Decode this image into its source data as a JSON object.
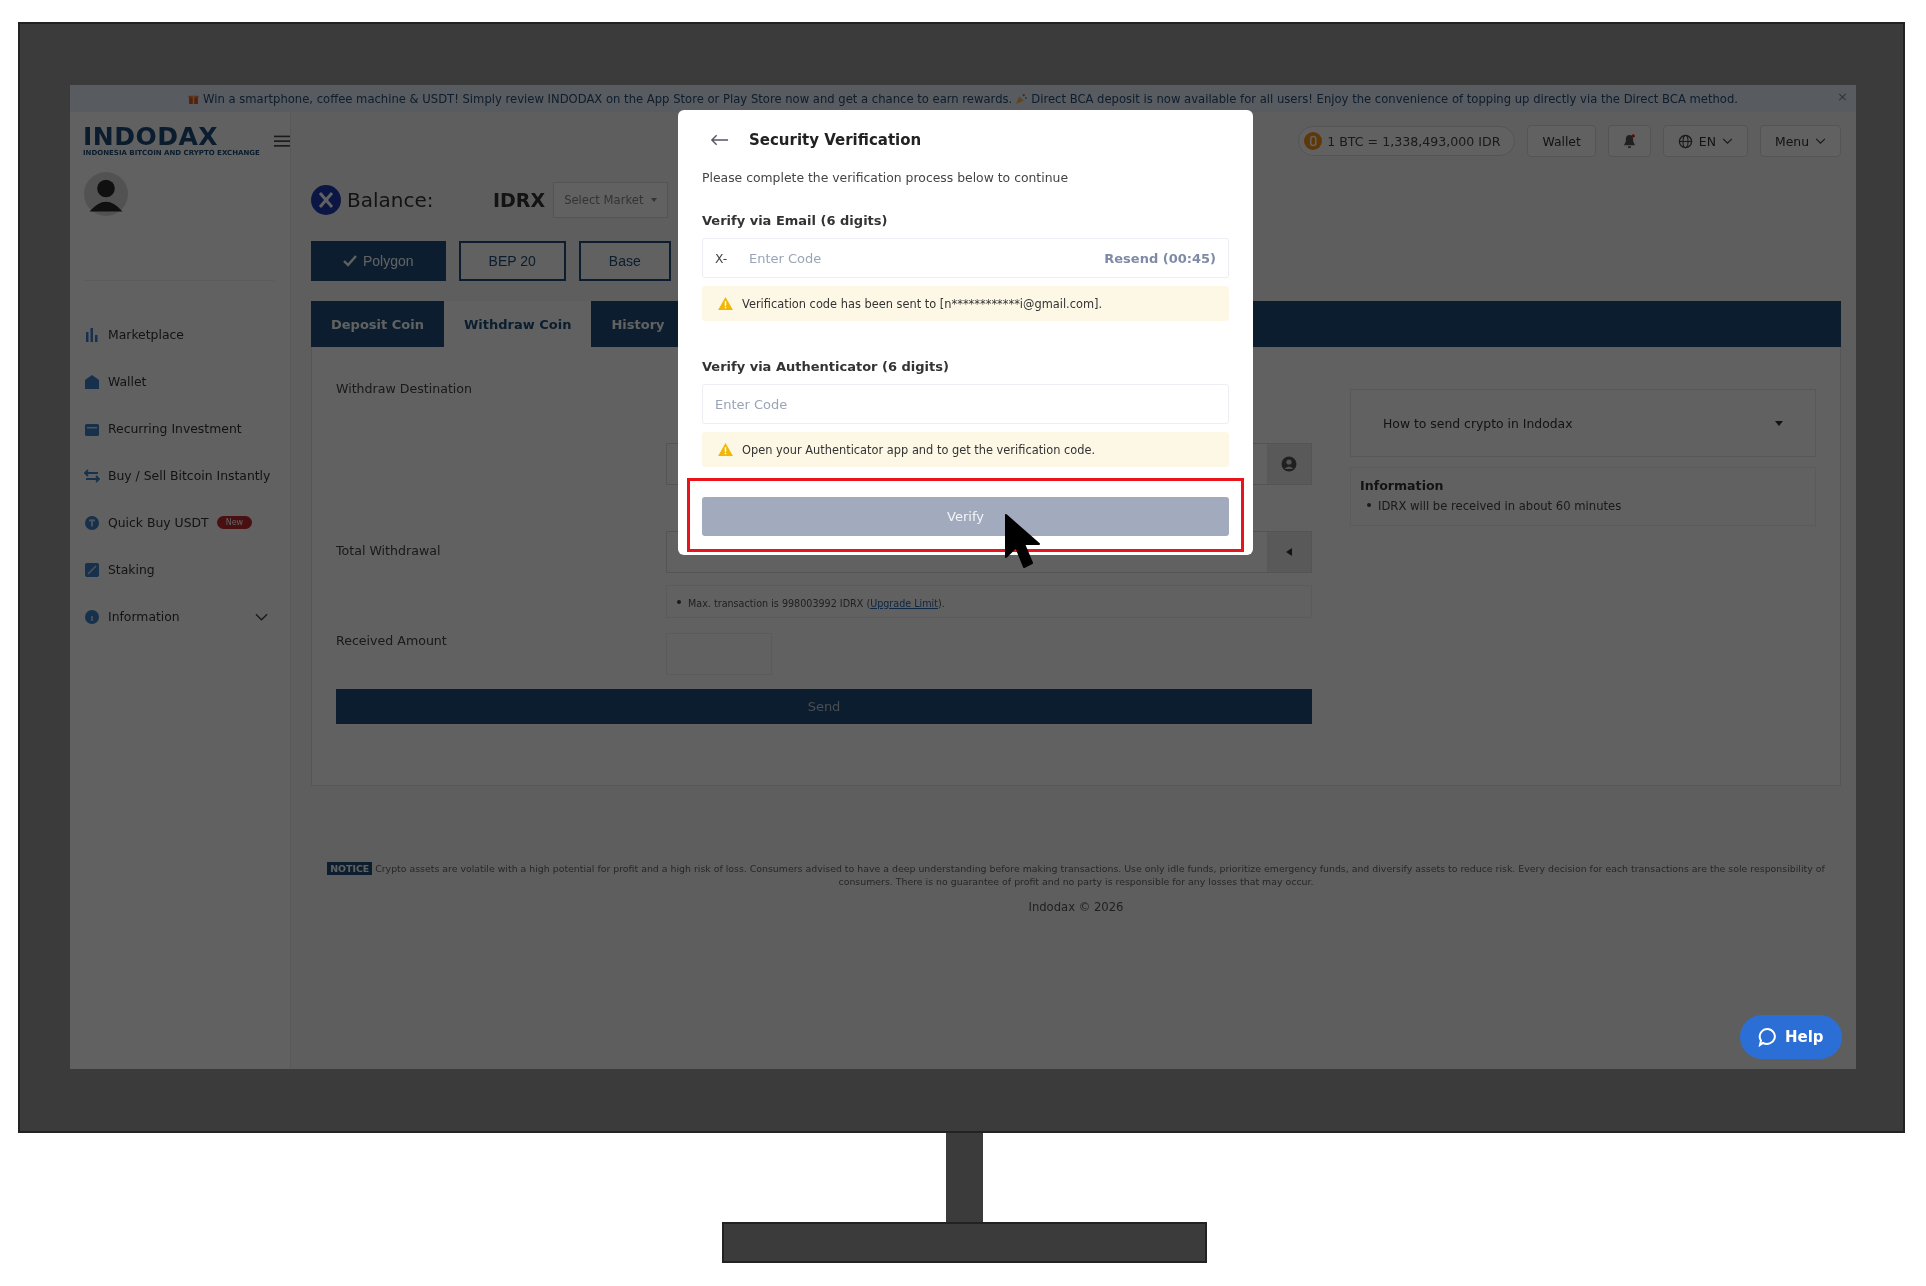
{
  "announcement": {
    "messages": [
      "Win a smartphone, coffee machine & USDT! Simply review INDODAX on the App Store or Play Store now and get a chance to earn rewards.",
      "Direct BCA deposit is now available for all users! Enjoy the convenience of topping up directly via the Direct BCA method."
    ],
    "close": "×"
  },
  "header": {
    "logo": "INDODAX",
    "tagline": "INDONESIA BITCOIN AND CRYPTO EXCHANGE",
    "ticker": "1 BTC = 1,338,493,000 IDR",
    "wallet": "Wallet",
    "language": "EN",
    "menu": "Menu"
  },
  "sidebar": {
    "items": [
      {
        "kind": "chart",
        "label": "Marketplace"
      },
      {
        "kind": "wallet",
        "label": "Wallet"
      },
      {
        "kind": "calendar",
        "label": "Recurring Investment"
      },
      {
        "kind": "swap",
        "label": "Buy / Sell Bitcoin Instantly"
      },
      {
        "kind": "coin",
        "label": "Quick Buy USDT",
        "badge": "New"
      },
      {
        "kind": "percent",
        "label": "Staking"
      },
      {
        "kind": "info",
        "label": "Information",
        "expanded": false
      }
    ]
  },
  "balance": {
    "label": "Balance:",
    "currency": "IDRX",
    "market_placeholder": "Select Market"
  },
  "networks": [
    {
      "label": "Polygon",
      "selected": true
    },
    {
      "label": "BEP 20",
      "selected": false
    },
    {
      "label": "Base",
      "selected": false
    }
  ],
  "tabs": [
    {
      "label": "Deposit Coin",
      "selected": false
    },
    {
      "label": "Withdraw Coin",
      "selected": true
    },
    {
      "label": "History",
      "selected": false
    }
  ],
  "form": {
    "withdraw_destination": "Withdraw Destination",
    "total_withdrawal": "Total Withdrawal",
    "received_amount": "Received Amount",
    "limit_note_before": "Max. transaction is 998003992 IDRX (",
    "limit_link": "Upgrade Limit",
    "limit_note_after": ").",
    "send": "Send"
  },
  "guide": {
    "title": "How to send crypto in Indodax"
  },
  "info": {
    "title": "Information",
    "items": [
      "IDRX will be received in about 60 minutes"
    ]
  },
  "notice": {
    "badge": "NOTICE",
    "text": "Crypto assets are volatile with a high potential for profit and a high risk of loss. Consumers advised to have a deep understanding before making transactions. Use only idle funds, prioritize emergency funds, and diversify assets to reduce risk. Every decision for each transactions are the sole responsibility of consumers. There is no guarantee of profit and no party is responsible for any losses that may occur."
  },
  "copyright": "Indodax © 2026",
  "help": "Help",
  "modal": {
    "title": "Security Verification",
    "subtitle": "Please complete the verification process below to continue",
    "email_label": "Verify via Email (6 digits)",
    "email_prefix": "X-",
    "email_placeholder": "Enter Code",
    "resend": "Resend (00:45)",
    "email_alert": "Verification code has been sent to [n************i@gmail.com].",
    "auth_label": "Verify via Authenticator (6 digits)",
    "auth_placeholder": "Enter Code",
    "auth_alert": "Open your Authenticator app and to get the verification code.",
    "verify": "Verify",
    "verify_disabled": true,
    "verify_highlighted": true
  }
}
